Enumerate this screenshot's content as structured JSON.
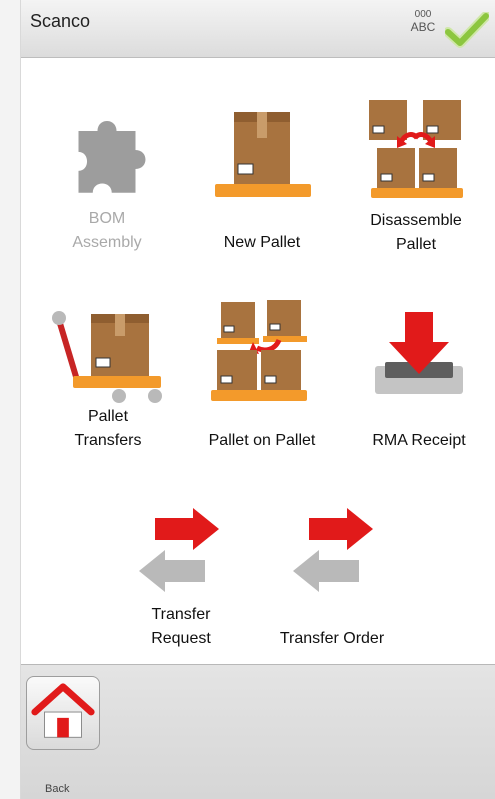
{
  "header": {
    "title": "Scanco",
    "status_line1": "000",
    "status_line2": "ABC",
    "confirm_icon": "check-icon"
  },
  "menu": {
    "bom_line1": "BOM",
    "bom_line2": "Assembly",
    "new_pallet": "New Pallet",
    "disassemble_line1": "Disassemble",
    "disassemble_line2": "Pallet",
    "pallet_transfers_line1": "Pallet",
    "pallet_transfers_line2": "Transfers",
    "pallet_on_pallet": "Pallet on Pallet",
    "rma_receipt": "RMA Receipt",
    "transfer_request_line1": "Transfer",
    "transfer_request_line2": "Request",
    "transfer_order": "Transfer Order"
  },
  "footer": {
    "back_label": "Back",
    "home_icon": "home-icon"
  },
  "colors": {
    "box_brown": "#a8733f",
    "pallet_orange": "#f39a2b",
    "arrow_red": "#e11a1a",
    "arrow_gray": "#b9b9b9",
    "check_green": "#8cc63f"
  }
}
